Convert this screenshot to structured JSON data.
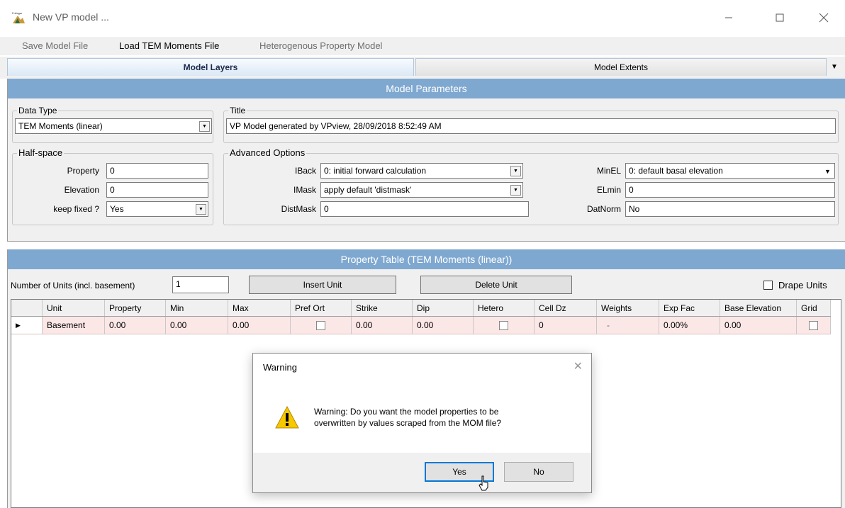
{
  "window": {
    "title": "New VP model ..."
  },
  "menu": {
    "save": "Save Model File",
    "load": "Load TEM Moments File",
    "hetero": "Heterogenous Property Model"
  },
  "tabs": [
    {
      "label": "Model Layers"
    },
    {
      "label": "Model Extents"
    }
  ],
  "params": {
    "header": "Model Parameters",
    "data_type": {
      "legend": "Data Type",
      "value": "TEM Moments (linear)"
    },
    "title": {
      "legend": "Title",
      "value": "VP Model generated by VPview, 28/09/2018 8:52:49 AM"
    },
    "half_space": {
      "legend": "Half-space",
      "property_label": "Property",
      "property_value": "0",
      "elevation_label": "Elevation",
      "elevation_value": "0",
      "fixed_label": "keep fixed ?",
      "fixed_value": "Yes"
    },
    "advanced": {
      "legend": "Advanced Options",
      "iback_label": "IBack",
      "iback_value": "0: initial forward calculation",
      "imask_label": "IMask",
      "imask_value": "apply default 'distmask'",
      "distmask_label": "DistMask",
      "distmask_value": "0",
      "minel_label": "MinEL",
      "minel_value": "0: default basal elevation",
      "elmin_label": "ELmin",
      "elmin_value": "0",
      "datnorm_label": "DatNorm",
      "datnorm_value": "No"
    }
  },
  "property_table": {
    "header": "Property Table (TEM Moments (linear))",
    "units_label": "Number of Units (incl. basement)",
    "units_value": "1",
    "insert_button": "Insert Unit",
    "delete_button": "Delete Unit",
    "drape_label": "Drape Units",
    "columns": [
      "Unit",
      "Property",
      "Min",
      "Max",
      "Pref Ort",
      "Strike",
      "Dip",
      "Hetero",
      "Cell Dz",
      "Weights",
      "Exp Fac",
      "Base Elevation",
      "Grid"
    ],
    "rows": [
      {
        "unit": "Basement",
        "property": "0.00",
        "min": "0.00",
        "max": "0.00",
        "strike": "0.00",
        "dip": "0.00",
        "cell_dz": "0",
        "weights": "-",
        "exp_fac": "0.00%",
        "base_elevation": "0.00"
      }
    ]
  },
  "dialog": {
    "title": "Warning",
    "message_line1": "Warning: Do you want the model properties to be",
    "message_line2": "overwritten by values scraped from the MOM file?",
    "yes": "Yes",
    "no": "No"
  },
  "icons": {
    "warning_color": "#f7c700",
    "header_color": "#7fa8d0"
  }
}
